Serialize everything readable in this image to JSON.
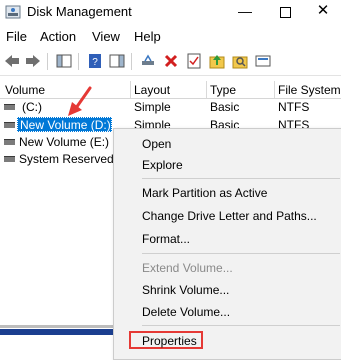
{
  "window": {
    "title": "Disk Management",
    "minimize_glyph": "—",
    "close_glyph": "✕"
  },
  "menu": [
    "File",
    "Action",
    "View",
    "Help"
  ],
  "toolbar_icons": [
    "back-arrow-icon",
    "forward-arrow-icon",
    "console-tree-icon",
    "help-icon",
    "action-pane-icon",
    "connect-icon",
    "delete-icon",
    "properties-icon",
    "up-folder-icon",
    "search-icon",
    "settings-icon"
  ],
  "table": {
    "columns": [
      "Volume",
      "Layout",
      "Type",
      "File System"
    ],
    "rows": [
      {
        "volume": "(C:)",
        "layout": "Simple",
        "type": "Basic",
        "fs": "NTFS"
      },
      {
        "volume": "New Volume (D:)",
        "layout": "Simple",
        "type": "Basic",
        "fs": "NTFS"
      },
      {
        "volume": "New Volume (E:)",
        "layout": "",
        "type": "",
        "fs": ""
      },
      {
        "volume": "System Reserved",
        "layout": "",
        "type": "",
        "fs": ""
      }
    ]
  },
  "context_menu": {
    "items": [
      {
        "label": "Open",
        "enabled": true
      },
      {
        "label": "Explore",
        "enabled": true
      },
      {
        "label": "Mark Partition as Active",
        "enabled": true
      },
      {
        "label": "Change Drive Letter and Paths...",
        "enabled": true
      },
      {
        "label": "Format...",
        "enabled": true
      },
      {
        "label": "Extend Volume...",
        "enabled": false
      },
      {
        "label": "Shrink Volume...",
        "enabled": true
      },
      {
        "label": "Delete Volume...",
        "enabled": true
      },
      {
        "label": "Properties",
        "enabled": true
      }
    ]
  },
  "colors": {
    "selection": "#0078d7",
    "highlight_box": "#e53935",
    "arrow": "#e53935"
  }
}
